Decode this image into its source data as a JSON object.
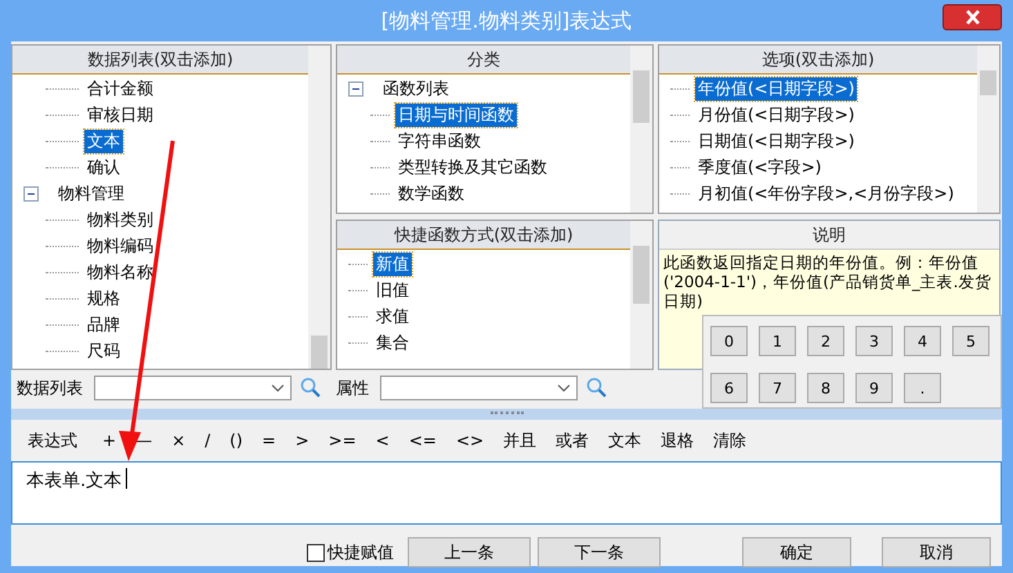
{
  "window": {
    "title": "[物料管理.物料类别]表达式"
  },
  "data_list": {
    "header": "数据列表(双击添加)",
    "nodes": [
      {
        "children": [
          {
            "label": "合计金额",
            "selected": false
          },
          {
            "label": "审核日期",
            "selected": false
          },
          {
            "label": "文本",
            "selected": true
          },
          {
            "label": "确认",
            "selected": false
          }
        ]
      },
      {
        "label": "物料管理",
        "selected": false,
        "expanded": true,
        "children": [
          {
            "label": "物料类别",
            "selected": false
          },
          {
            "label": "物料编码",
            "selected": false
          },
          {
            "label": "物料名称",
            "selected": false
          },
          {
            "label": "规格",
            "selected": false
          },
          {
            "label": "品牌",
            "selected": false
          },
          {
            "label": "尺码",
            "selected": false
          }
        ]
      }
    ]
  },
  "category": {
    "header": "分类",
    "nodes": [
      {
        "label": "函数列表",
        "selected": false,
        "expanded": true,
        "children": [
          {
            "label": "日期与时间函数",
            "selected": true
          },
          {
            "label": "字符串函数",
            "selected": false
          },
          {
            "label": "类型转换及其它函数",
            "selected": false
          },
          {
            "label": "数学函数",
            "selected": false
          }
        ]
      }
    ]
  },
  "options": {
    "header": "选项(双击添加)",
    "items": [
      {
        "label": "年份值(<日期字段>)",
        "selected": true
      },
      {
        "label": "月份值(<日期字段>)",
        "selected": false
      },
      {
        "label": "日期值(<日期字段>)",
        "selected": false
      },
      {
        "label": "季度值(<字段>)",
        "selected": false
      },
      {
        "label": "月初值(<年份字段>,<月份字段>)",
        "selected": false
      }
    ]
  },
  "quick": {
    "header": "快捷函数方式(双击添加)",
    "items": [
      {
        "label": "新值",
        "selected": true
      },
      {
        "label": "旧值",
        "selected": false
      },
      {
        "label": "求值",
        "selected": false
      },
      {
        "label": "集合",
        "selected": false
      }
    ]
  },
  "description": {
    "header": "说明",
    "text": "此函数返回指定日期的年份值。例：年份值('2004-1-1')，年份值(产品销货单_主表.发货日期)"
  },
  "keypad": [
    "0",
    "1",
    "2",
    "3",
    "4",
    "5",
    "6",
    "7",
    "8",
    "9",
    "."
  ],
  "filters": [
    {
      "label": "数据列表"
    },
    {
      "label": "属性"
    }
  ],
  "toolbar": {
    "label": "表达式",
    "operators": [
      "+",
      "—",
      "×",
      "/",
      "()",
      "=",
      ">",
      ">=",
      "<",
      "<=",
      "<>",
      "并且",
      "或者",
      "文本",
      "退格",
      "清除"
    ]
  },
  "expression": {
    "value": "本表单.文本"
  },
  "quick_assign": {
    "label": "快捷赋值",
    "checked": false
  },
  "buttons": [
    {
      "label": "上一条",
      "kind": "nav"
    },
    {
      "label": "下一条",
      "kind": "nav"
    },
    {
      "label": "确定",
      "kind": "dialog"
    },
    {
      "label": "取消",
      "kind": "dialog"
    }
  ]
}
